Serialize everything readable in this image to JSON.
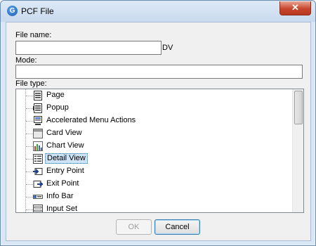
{
  "window": {
    "title": "PCF File",
    "app_icon": "G",
    "close_glyph": "✕"
  },
  "form": {
    "file_name_label": "File name:",
    "file_name_value": "",
    "file_name_suffix": "DV",
    "mode_label": "Mode:",
    "mode_value": "",
    "file_type_label": "File type:"
  },
  "file_types": [
    {
      "label": "Page",
      "icon": "page-icon",
      "selected": false
    },
    {
      "label": "Popup",
      "icon": "popup-icon",
      "selected": false
    },
    {
      "label": "Accelerated Menu Actions",
      "icon": "menu-actions-icon",
      "selected": false
    },
    {
      "label": "Card View",
      "icon": "card-view-icon",
      "selected": false
    },
    {
      "label": "Chart View",
      "icon": "chart-view-icon",
      "selected": false
    },
    {
      "label": "Detail View",
      "icon": "detail-view-icon",
      "selected": true
    },
    {
      "label": "Entry Point",
      "icon": "entry-point-icon",
      "selected": false
    },
    {
      "label": "Exit Point",
      "icon": "exit-point-icon",
      "selected": false
    },
    {
      "label": "Info Bar",
      "icon": "info-bar-icon",
      "selected": false
    },
    {
      "label": "Input Set",
      "icon": "input-set-icon",
      "selected": false
    }
  ],
  "buttons": {
    "ok_label": "OK",
    "cancel_label": "Cancel"
  }
}
